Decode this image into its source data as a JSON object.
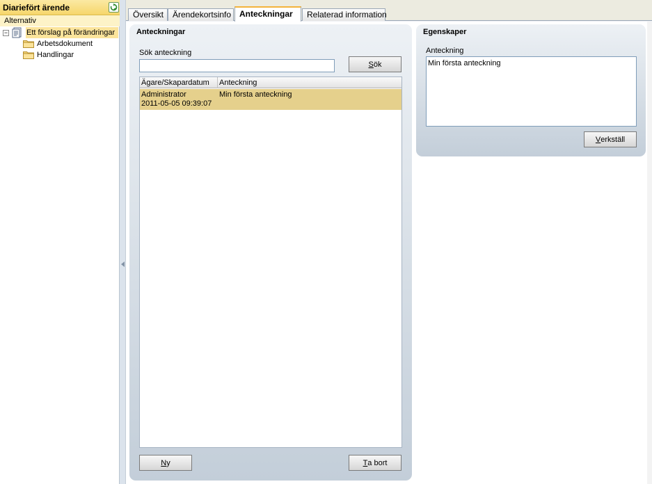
{
  "left_panel": {
    "title": "Diariefört ärende",
    "alternative_label": "Alternativ",
    "tree": {
      "root_label": "Ett förslag på förändringar",
      "children": [
        "Arbetsdokument",
        "Handlingar"
      ]
    }
  },
  "tabs": [
    "Översikt",
    "Ärendekortsinfo",
    "Anteckningar",
    "Relaterad information"
  ],
  "active_tab": "Anteckningar",
  "notes_panel": {
    "title": "Anteckningar",
    "search_label": "Sök anteckning",
    "search_value": "",
    "search_button": {
      "key": "S",
      "rest": "ök"
    },
    "columns": [
      "Ägare/Skapardatum",
      "Anteckning"
    ],
    "rows": [
      {
        "owner": "Administrator",
        "created": "2011-05-05 09:39:07",
        "note": "Min första anteckning"
      }
    ],
    "new_button": {
      "key": "N",
      "rest": "y"
    },
    "delete_button": {
      "key": "T",
      "rest": "a bort"
    }
  },
  "properties_panel": {
    "title": "Egenskaper",
    "note_label": "Anteckning",
    "note_value": "Min första anteckning",
    "apply_button": {
      "key": "V",
      "rest": "erkställ"
    }
  },
  "colors": {
    "header_yellow": "#f6d66b",
    "selection": "#e5d08c",
    "panel_blue": "#c3ced9",
    "active_tab_accent": "#f4b33a"
  }
}
